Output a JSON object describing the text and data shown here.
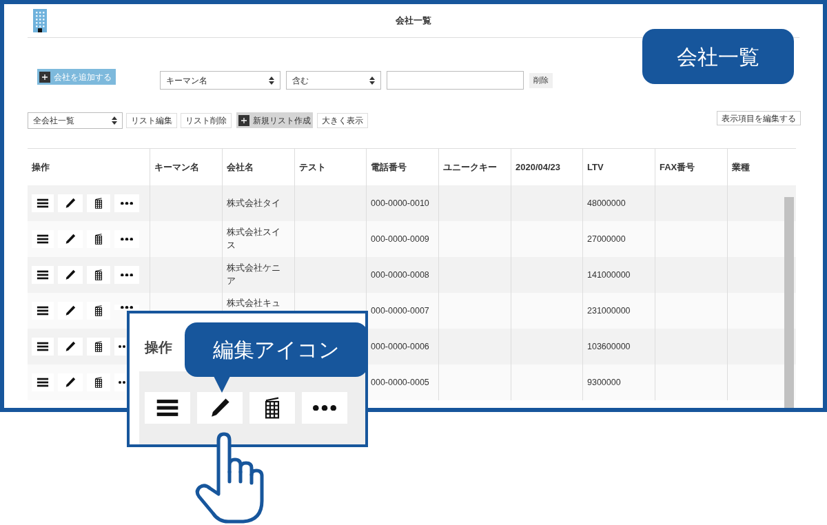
{
  "header": {
    "title": "会社一覧"
  },
  "callout_title": "会社一覧",
  "add_button": "会社を追加する",
  "filter": {
    "field": "キーマン名",
    "operator": "含む",
    "delete": "削除"
  },
  "list_bar": {
    "list": "全会社一覧",
    "buttons": [
      "リスト編集",
      "リスト削除"
    ],
    "new_list": "新規リスト作成",
    "enlarge": "大きく表示",
    "edit_columns": "表示項目を編集する"
  },
  "table": {
    "columns": [
      "操作",
      "キーマン名",
      "会社名",
      "テスト",
      "電話番号",
      "ユニークキー",
      "2020/04/23",
      "LTV",
      "FAX番号",
      "業種"
    ],
    "rows": [
      {
        "company": "株式会社タイ",
        "phone": "000-0000-0010",
        "ltv": "48000000"
      },
      {
        "company": "株式会社スイス",
        "phone": "000-0000-0009",
        "ltv": "27000000"
      },
      {
        "company": "株式会社ケニア",
        "phone": "000-0000-0008",
        "ltv": "141000000"
      },
      {
        "company": "株式会社キュ",
        "phone": "000-0000-0007",
        "ltv": "231000000"
      },
      {
        "phone": "000-0000-0006",
        "ltv": "103600000"
      },
      {
        "phone": "000-0000-0005",
        "ltv": "9300000"
      }
    ]
  },
  "zoom_inset": {
    "heading": "操作",
    "callout": "編集アイコン"
  }
}
